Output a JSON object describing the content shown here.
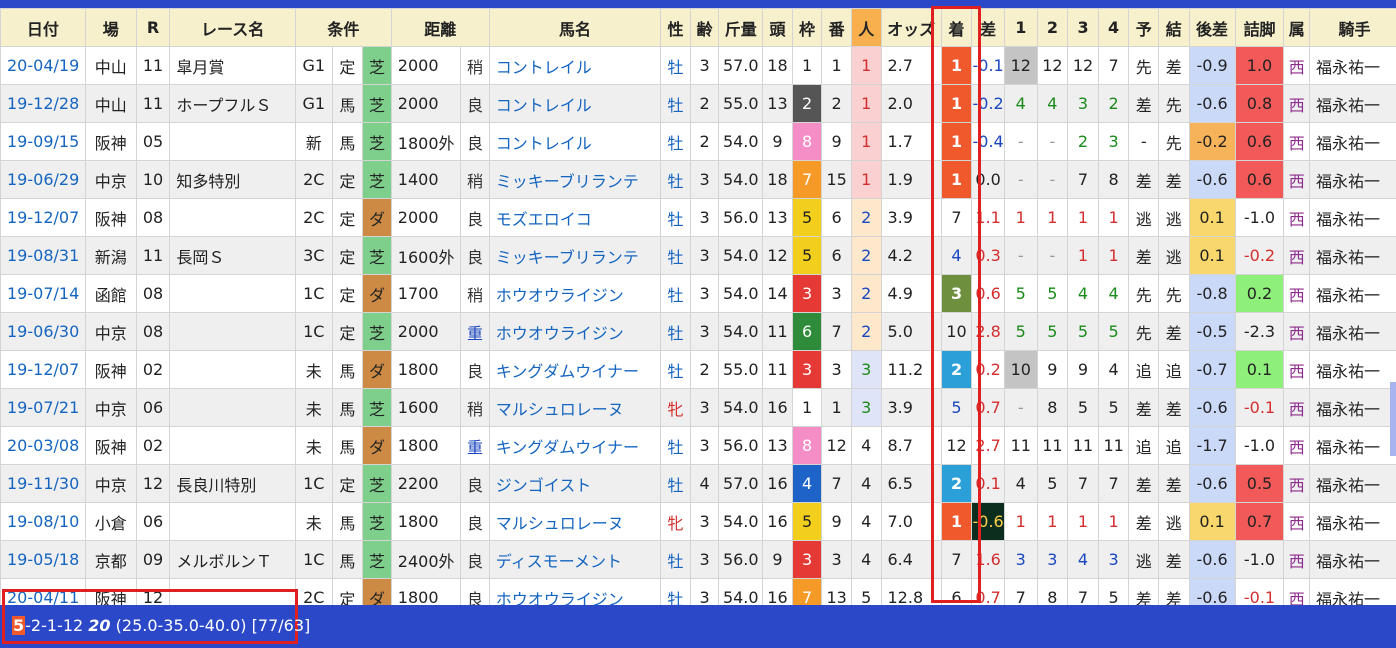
{
  "headers": [
    "日付",
    "場",
    "R",
    "レース名",
    "条件",
    "",
    "",
    "距離",
    "",
    "馬名",
    "性",
    "齢",
    "斤量",
    "頭",
    "枠",
    "番",
    "人",
    "オッズ",
    "着",
    "差",
    "1",
    "2",
    "3",
    "4",
    "予",
    "結",
    "後差",
    "詰脚",
    "属",
    "騎手"
  ],
  "rows": [
    {
      "date": "20-04/19",
      "course": "中山",
      "r": "11",
      "name": "皐月賞",
      "cls": "G1",
      "w": "定",
      "surf": "芝",
      "dist": "2000",
      "cond": "稍",
      "horse": "コントレイル",
      "sex": "牡",
      "age": "3",
      "kin": "57.0",
      "heads": "18",
      "frame": "1",
      "num": "1",
      "pop": "1",
      "odds": "2.7",
      "res": "1",
      "diff": "-0.1",
      "c1": "12",
      "c2": "12",
      "c3": "12",
      "c4": "7",
      "yo": "先",
      "ke": "差",
      "gosa": "-0.9",
      "tsume": "1.0",
      "zoku": "西",
      "jockey": "福永祐一"
    },
    {
      "date": "19-12/28",
      "course": "中山",
      "r": "11",
      "name": "ホープフルＳ",
      "cls": "G1",
      "w": "馬",
      "surf": "芝",
      "dist": "2000",
      "cond": "良",
      "horse": "コントレイル",
      "sex": "牡",
      "age": "2",
      "kin": "55.0",
      "heads": "13",
      "frame": "2",
      "num": "2",
      "pop": "1",
      "odds": "2.0",
      "res": "1",
      "diff": "-0.2",
      "c1": "4",
      "c2": "4",
      "c3": "3",
      "c4": "2",
      "yo": "差",
      "ke": "先",
      "gosa": "-0.6",
      "tsume": "0.8",
      "zoku": "西",
      "jockey": "福永祐一"
    },
    {
      "date": "19-09/15",
      "course": "阪神",
      "r": "05",
      "name": "",
      "cls": "新",
      "w": "馬",
      "surf": "芝",
      "dist": "1800外",
      "cond": "良",
      "horse": "コントレイル",
      "sex": "牡",
      "age": "2",
      "kin": "54.0",
      "heads": "9",
      "frame": "8",
      "num": "9",
      "pop": "1",
      "odds": "1.7",
      "res": "1",
      "diff": "-0.4",
      "c1": "-",
      "c2": "-",
      "c3": "2",
      "c4": "3",
      "yo": "-",
      "ke": "先",
      "gosa": "-0.2",
      "tsume": "0.6",
      "zoku": "西",
      "jockey": "福永祐一"
    },
    {
      "date": "19-06/29",
      "course": "中京",
      "r": "10",
      "name": "知多特別",
      "cls": "2C",
      "w": "定",
      "surf": "芝",
      "dist": "1400",
      "cond": "稍",
      "horse": "ミッキーブリランテ",
      "sex": "牡",
      "age": "3",
      "kin": "54.0",
      "heads": "18",
      "frame": "7",
      "num": "15",
      "pop": "1",
      "odds": "1.9",
      "res": "1",
      "diff": "0.0",
      "c1": "-",
      "c2": "-",
      "c3": "7",
      "c4": "8",
      "yo": "差",
      "ke": "差",
      "gosa": "-0.6",
      "tsume": "0.6",
      "zoku": "西",
      "jockey": "福永祐一"
    },
    {
      "date": "19-12/07",
      "course": "阪神",
      "r": "08",
      "name": "",
      "cls": "2C",
      "w": "定",
      "surf": "ダ",
      "dist": "2000",
      "cond": "良",
      "horse": "モズエロイコ",
      "sex": "牡",
      "age": "3",
      "kin": "56.0",
      "heads": "13",
      "frame": "5",
      "num": "6",
      "pop": "2",
      "odds": "3.9",
      "res": "7",
      "diff": "1.1",
      "c1": "1",
      "c2": "1",
      "c3": "1",
      "c4": "1",
      "yo": "逃",
      "ke": "逃",
      "gosa": "0.1",
      "tsume": "-1.0",
      "zoku": "西",
      "jockey": "福永祐一"
    },
    {
      "date": "19-08/31",
      "course": "新潟",
      "r": "11",
      "name": "長岡Ｓ",
      "cls": "3C",
      "w": "定",
      "surf": "芝",
      "dist": "1600外",
      "cond": "良",
      "horse": "ミッキーブリランテ",
      "sex": "牡",
      "age": "3",
      "kin": "54.0",
      "heads": "12",
      "frame": "5",
      "num": "6",
      "pop": "2",
      "odds": "4.2",
      "res": "4",
      "diff": "0.3",
      "c1": "-",
      "c2": "-",
      "c3": "1",
      "c4": "1",
      "yo": "差",
      "ke": "逃",
      "gosa": "0.1",
      "tsume": "-0.2",
      "zoku": "西",
      "jockey": "福永祐一"
    },
    {
      "date": "19-07/14",
      "course": "函館",
      "r": "08",
      "name": "",
      "cls": "1C",
      "w": "定",
      "surf": "ダ",
      "dist": "1700",
      "cond": "稍",
      "horse": "ホウオウライジン",
      "sex": "牡",
      "age": "3",
      "kin": "54.0",
      "heads": "14",
      "frame": "3",
      "num": "3",
      "pop": "2",
      "odds": "4.9",
      "res": "3",
      "diff": "0.6",
      "c1": "5",
      "c2": "5",
      "c3": "4",
      "c4": "4",
      "yo": "先",
      "ke": "先",
      "gosa": "-0.8",
      "tsume": "0.2",
      "zoku": "西",
      "jockey": "福永祐一"
    },
    {
      "date": "19-06/30",
      "course": "中京",
      "r": "08",
      "name": "",
      "cls": "1C",
      "w": "定",
      "surf": "芝",
      "dist": "2000",
      "cond": "重",
      "horse": "ホウオウライジン",
      "sex": "牡",
      "age": "3",
      "kin": "54.0",
      "heads": "11",
      "frame": "6",
      "num": "7",
      "pop": "2",
      "odds": "5.0",
      "res": "10",
      "diff": "2.8",
      "c1": "5",
      "c2": "5",
      "c3": "5",
      "c4": "5",
      "yo": "先",
      "ke": "差",
      "gosa": "-0.5",
      "tsume": "-2.3",
      "zoku": "西",
      "jockey": "福永祐一"
    },
    {
      "date": "19-12/07",
      "course": "阪神",
      "r": "02",
      "name": "",
      "cls": "未",
      "w": "馬",
      "surf": "ダ",
      "dist": "1800",
      "cond": "良",
      "horse": "キングダムウイナー",
      "sex": "牡",
      "age": "2",
      "kin": "55.0",
      "heads": "11",
      "frame": "3",
      "num": "3",
      "pop": "3",
      "odds": "11.2",
      "res": "2",
      "diff": "0.2",
      "c1": "10",
      "c2": "9",
      "c3": "9",
      "c4": "4",
      "yo": "追",
      "ke": "追",
      "gosa": "-0.7",
      "tsume": "0.1",
      "zoku": "西",
      "jockey": "福永祐一"
    },
    {
      "date": "19-07/21",
      "course": "中京",
      "r": "06",
      "name": "",
      "cls": "未",
      "w": "馬",
      "surf": "芝",
      "dist": "1600",
      "cond": "稍",
      "horse": "マルシュロレーヌ",
      "sex": "牝",
      "age": "3",
      "kin": "54.0",
      "heads": "16",
      "frame": "1",
      "num": "1",
      "pop": "3",
      "odds": "3.9",
      "res": "5",
      "diff": "0.7",
      "c1": "-",
      "c2": "8",
      "c3": "5",
      "c4": "5",
      "yo": "差",
      "ke": "差",
      "gosa": "-0.6",
      "tsume": "-0.1",
      "zoku": "西",
      "jockey": "福永祐一"
    },
    {
      "date": "20-03/08",
      "course": "阪神",
      "r": "02",
      "name": "",
      "cls": "未",
      "w": "馬",
      "surf": "ダ",
      "dist": "1800",
      "cond": "重",
      "horse": "キングダムウイナー",
      "sex": "牡",
      "age": "3",
      "kin": "56.0",
      "heads": "13",
      "frame": "8",
      "num": "12",
      "pop": "4",
      "odds": "8.7",
      "res": "12",
      "diff": "2.7",
      "c1": "11",
      "c2": "11",
      "c3": "11",
      "c4": "11",
      "yo": "追",
      "ke": "追",
      "gosa": "-1.7",
      "tsume": "-1.0",
      "zoku": "西",
      "jockey": "福永祐一"
    },
    {
      "date": "19-11/30",
      "course": "中京",
      "r": "12",
      "name": "長良川特別",
      "cls": "1C",
      "w": "定",
      "surf": "芝",
      "dist": "2200",
      "cond": "良",
      "horse": "ジンゴイスト",
      "sex": "牡",
      "age": "4",
      "kin": "57.0",
      "heads": "16",
      "frame": "4",
      "num": "7",
      "pop": "4",
      "odds": "6.5",
      "res": "2",
      "diff": "0.1",
      "c1": "4",
      "c2": "5",
      "c3": "7",
      "c4": "7",
      "yo": "差",
      "ke": "差",
      "gosa": "-0.6",
      "tsume": "0.5",
      "zoku": "西",
      "jockey": "福永祐一"
    },
    {
      "date": "19-08/10",
      "course": "小倉",
      "r": "06",
      "name": "",
      "cls": "未",
      "w": "馬",
      "surf": "芝",
      "dist": "1800",
      "cond": "良",
      "horse": "マルシュロレーヌ",
      "sex": "牝",
      "age": "3",
      "kin": "54.0",
      "heads": "16",
      "frame": "5",
      "num": "9",
      "pop": "4",
      "odds": "7.0",
      "res": "1",
      "diff": "-0.6",
      "c1": "1",
      "c2": "1",
      "c3": "1",
      "c4": "1",
      "yo": "差",
      "ke": "逃",
      "gosa": "0.1",
      "tsume": "0.7",
      "zoku": "西",
      "jockey": "福永祐一"
    },
    {
      "date": "19-05/18",
      "course": "京都",
      "r": "09",
      "name": "メルボルンＴ",
      "cls": "1C",
      "w": "馬",
      "surf": "芝",
      "dist": "2400外",
      "cond": "良",
      "horse": "ディスモーメント",
      "sex": "牡",
      "age": "3",
      "kin": "56.0",
      "heads": "9",
      "frame": "3",
      "num": "3",
      "pop": "4",
      "odds": "6.4",
      "res": "7",
      "diff": "1.6",
      "c1": "3",
      "c2": "3",
      "c3": "4",
      "c4": "3",
      "yo": "逃",
      "ke": "差",
      "gosa": "-0.6",
      "tsume": "-1.0",
      "zoku": "西",
      "jockey": "福永祐一"
    },
    {
      "date": "20-04/11",
      "course": "阪神",
      "r": "12",
      "name": "",
      "cls": "2C",
      "w": "定",
      "surf": "ダ",
      "dist": "1800",
      "cond": "良",
      "horse": "ホウオウライジン",
      "sex": "牡",
      "age": "3",
      "kin": "54.0",
      "heads": "16",
      "frame": "7",
      "num": "13",
      "pop": "5",
      "odds": "12.8",
      "res": "6",
      "diff": "0.7",
      "c1": "7",
      "c2": "8",
      "c3": "7",
      "c4": "5",
      "yo": "差",
      "ke": "差",
      "gosa": "-0.6",
      "tsume": "-0.1",
      "zoku": "西",
      "jockey": "福永祐一"
    }
  ],
  "summary": {
    "wins": "5",
    "rest": "-2-1-12",
    "total": "20",
    "rates": "(25.0-35.0-40.0)",
    "ratio": "[77/63]"
  }
}
